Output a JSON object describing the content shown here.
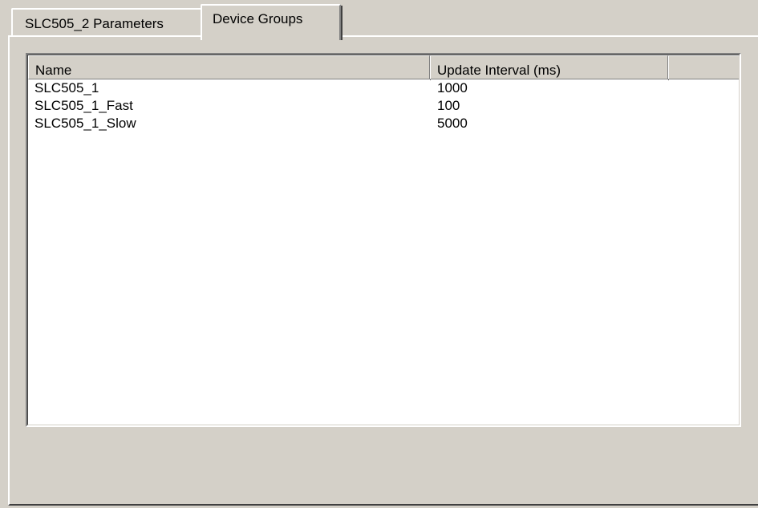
{
  "tabs": [
    {
      "label": "SLC505_2 Parameters",
      "active": false
    },
    {
      "label": "Device Groups",
      "active": true
    }
  ],
  "device_groups": {
    "columns": [
      "Name",
      "Update Interval (ms)"
    ],
    "rows": [
      {
        "name": "SLC505_1",
        "interval": "1000"
      },
      {
        "name": "SLC505_1_Fast",
        "interval": "100"
      },
      {
        "name": "SLC505_1_Slow",
        "interval": "5000"
      }
    ]
  }
}
